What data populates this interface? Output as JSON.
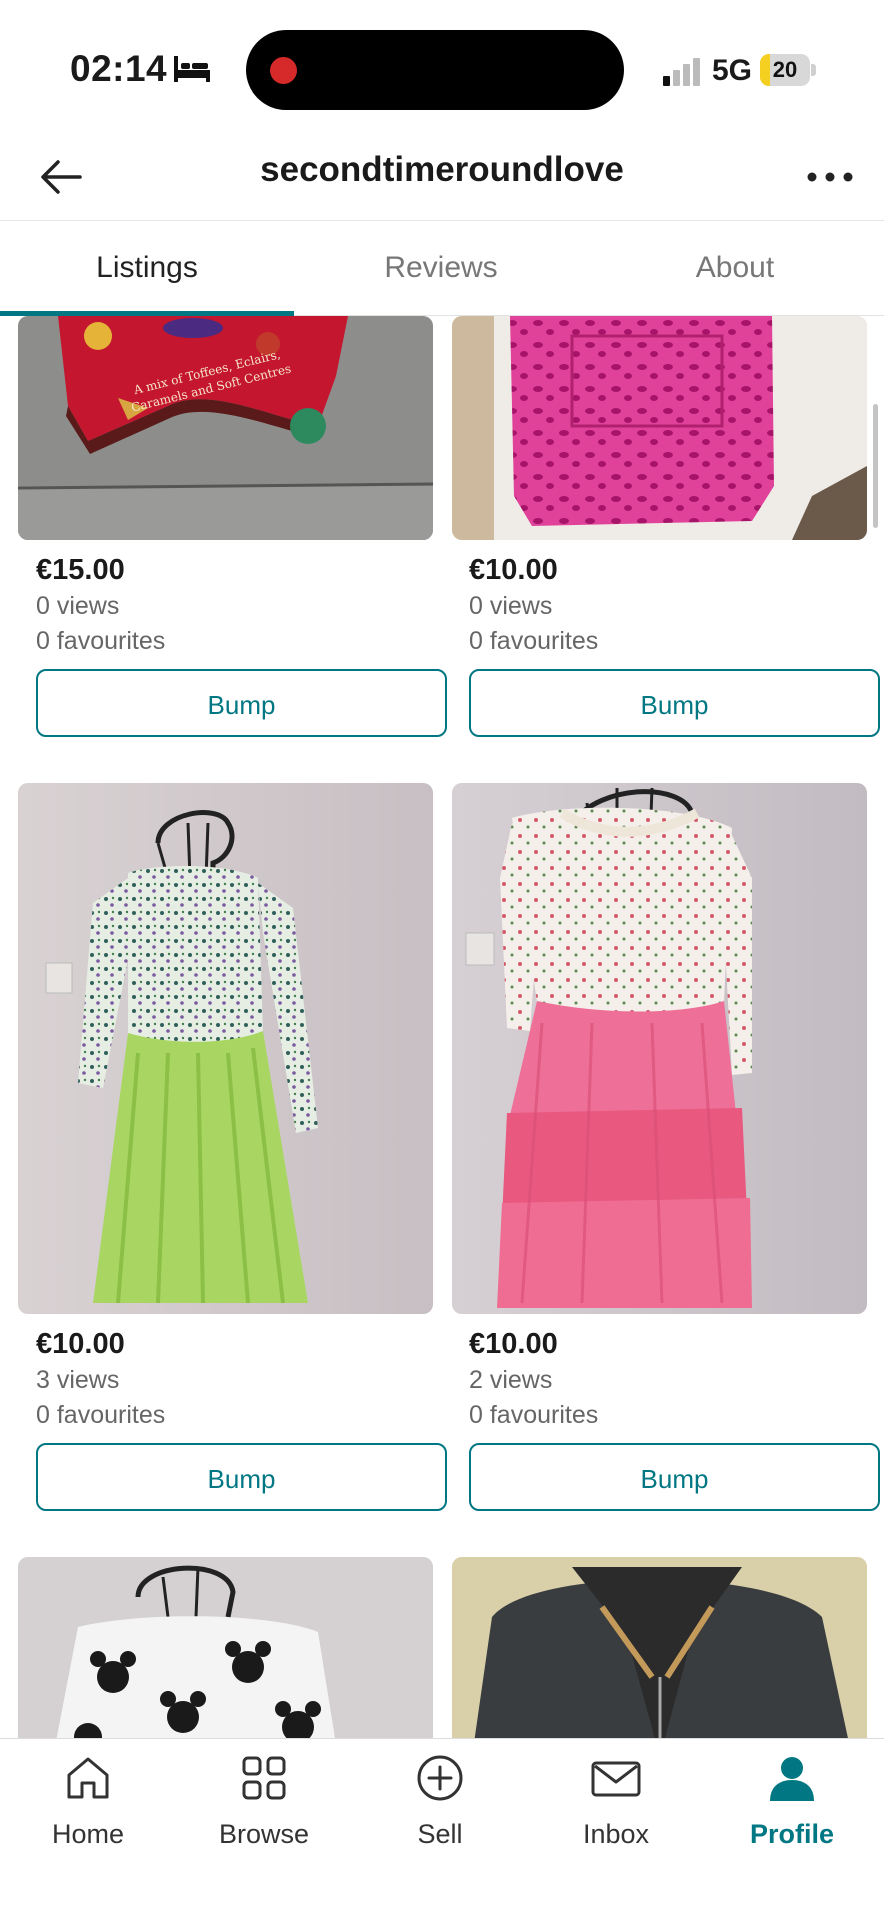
{
  "status_bar": {
    "time": "02:14",
    "network": "5G",
    "battery": "20",
    "battery_level": 0.2
  },
  "header": {
    "title": "secondtimeroundlove"
  },
  "tabs": [
    {
      "label": "Listings",
      "active": true
    },
    {
      "label": "Reviews",
      "active": false
    },
    {
      "label": "About",
      "active": false
    }
  ],
  "listings": [
    {
      "price": "€15.00",
      "views": "0 views",
      "favourites": "0 favourites",
      "bump_label": "Bump",
      "tin_text_1": "A mix of Toffees, Eclairs,",
      "tin_text_2": "Caramels and Soft Centres"
    },
    {
      "price": "€10.00",
      "views": "0 views",
      "favourites": "0 favourites",
      "bump_label": "Bump"
    },
    {
      "price": "€10.00",
      "views": "3 views",
      "favourites": "0 favourites",
      "bump_label": "Bump"
    },
    {
      "price": "€10.00",
      "views": "2 views",
      "favourites": "0 favourites",
      "bump_label": "Bump"
    }
  ],
  "bottom_nav": [
    {
      "label": "Home",
      "icon": "home-icon"
    },
    {
      "label": "Browse",
      "icon": "grid-icon"
    },
    {
      "label": "Sell",
      "icon": "plus-circle-icon"
    },
    {
      "label": "Inbox",
      "icon": "envelope-icon"
    },
    {
      "label": "Profile",
      "icon": "person-icon",
      "active": true
    }
  ],
  "colors": {
    "accent": "#007782"
  }
}
